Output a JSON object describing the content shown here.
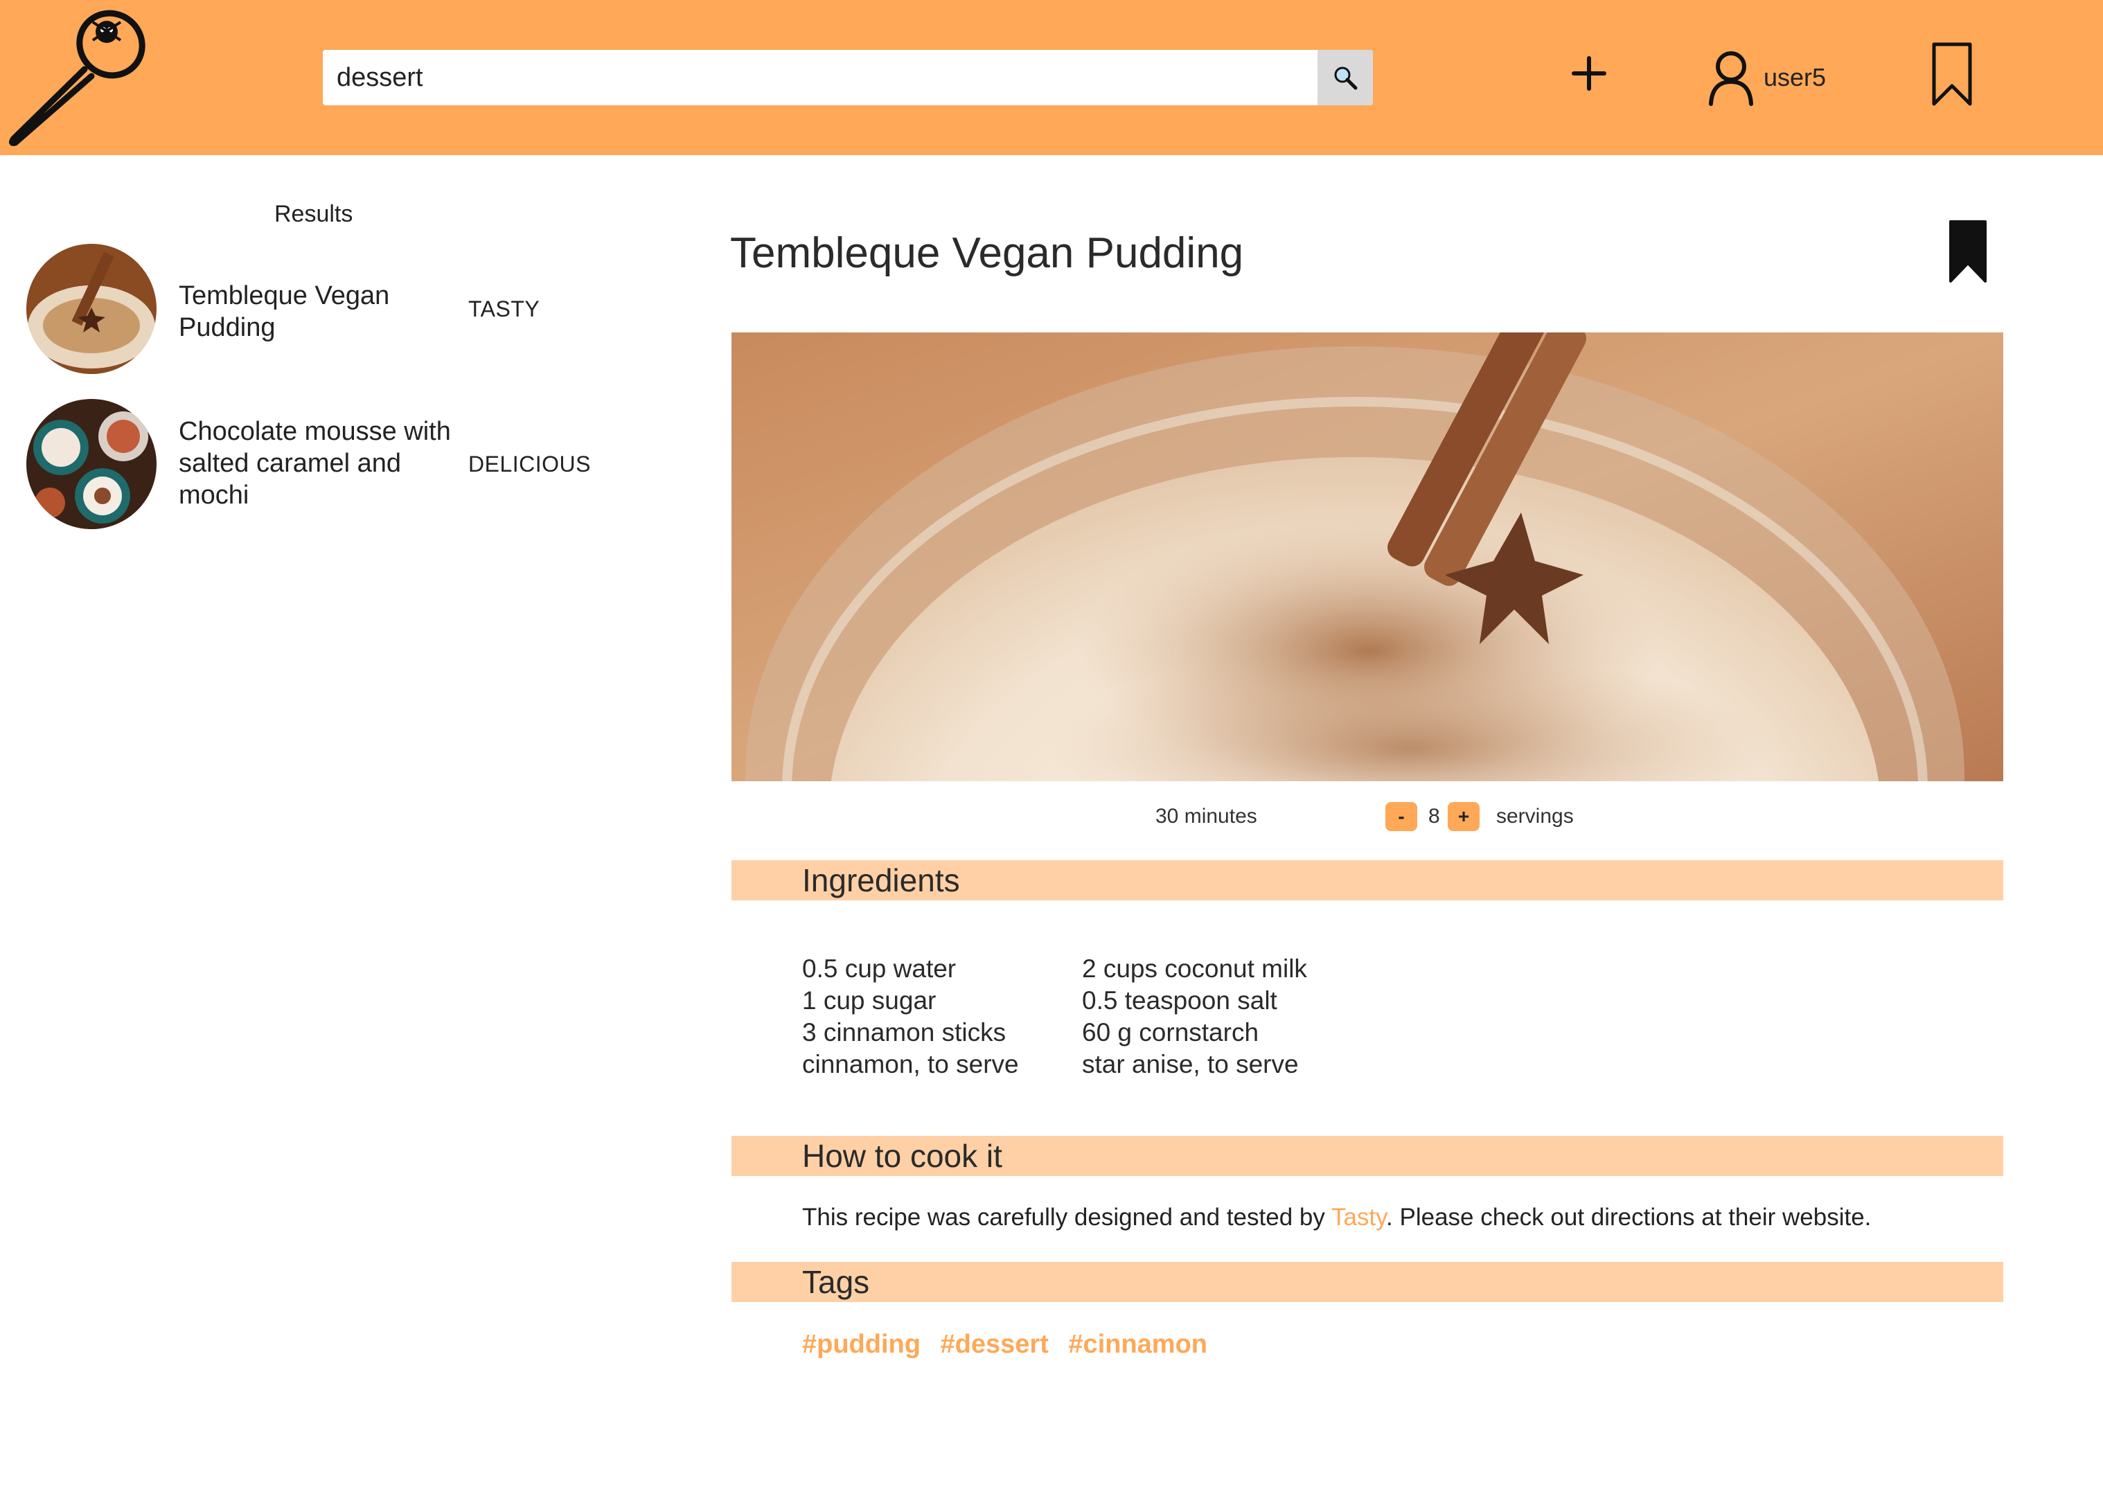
{
  "header": {
    "search": {
      "value": "dessert",
      "placeholder": ""
    },
    "user": {
      "name": "user5"
    }
  },
  "results": {
    "title": "Results",
    "items": [
      {
        "name": "Tembleque Vegan Pudding",
        "source": "TASTY"
      },
      {
        "name": "Chocolate mousse with salted caramel and mochi",
        "source": "DELICIOUS"
      }
    ]
  },
  "recipe": {
    "title": "Tembleque Vegan Pudding",
    "duration": "30 minutes",
    "servings": {
      "minus_label": "-",
      "plus_label": "+",
      "count": "8",
      "label": "servings"
    },
    "ingredients_title": "Ingredients",
    "ingredients_col1": [
      "0.5 cup water",
      "1 cup sugar",
      "3 cinnamon sticks",
      "cinnamon, to serve"
    ],
    "ingredients_col2": [
      "2 cups coconut milk",
      "0.5 teaspoon salt",
      "60 g cornstarch",
      "star anise, to serve"
    ],
    "how_title": "How to cook it",
    "how_text_before": "This recipe was carefully designed and tested by ",
    "how_source": "Tasty",
    "how_text_after": ". Please check out directions at their website.",
    "tags_title": "Tags",
    "tags": [
      "#pudding",
      "#dessert",
      "#cinnamon"
    ]
  },
  "colors": {
    "header_bg": "#ffa857",
    "section_bar": "#ffd0a6",
    "accent": "#ffa857"
  },
  "icons": [
    "spoon-logo-icon",
    "search-icon",
    "plus-icon",
    "user-icon",
    "bookmark-outline-icon",
    "bookmark-filled-icon"
  ]
}
